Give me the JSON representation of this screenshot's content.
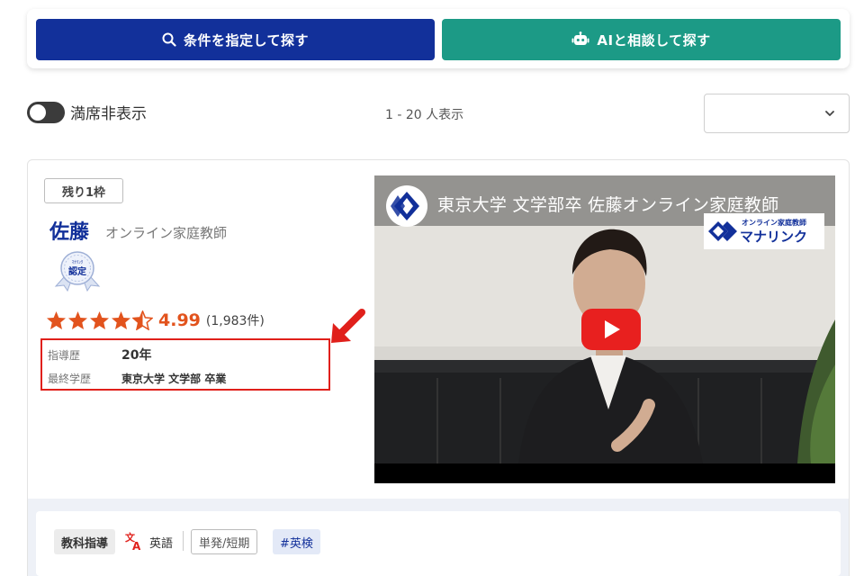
{
  "search": {
    "condition_button": "条件を指定して探す",
    "ai_button": "AIと相談して探す"
  },
  "filter": {
    "hide_full_label": "満席非表示",
    "result_count": "1 - 20 人表示",
    "sort_value": ""
  },
  "tutor": {
    "remaining_badge": "残り1枠",
    "name": "佐藤",
    "role": "オンライン家庭教師",
    "cert_small": "ﾏﾅﾘﾝｸ",
    "cert_main": "認定",
    "rating_stars": 4.5,
    "rating_score": "4.99",
    "review_count": "(1,983件)",
    "info": [
      {
        "label": "指導歴",
        "value": "20年"
      },
      {
        "label": "最終学歴",
        "value": "東京大学 文学部 卒業"
      }
    ]
  },
  "video": {
    "title": "東京大学 文学部卒 佐藤オンライン家庭教師",
    "brand_sub": "オンライン家庭教師",
    "brand_main": "マナリンク"
  },
  "tags": {
    "subject": "教科指導",
    "language": "英語",
    "term": "単発/短期",
    "hashtag": "#英検"
  },
  "colors": {
    "primary": "#12309a",
    "ai": "#1c9a86",
    "rating": "#e2531d",
    "highlight": "#e0201b"
  }
}
